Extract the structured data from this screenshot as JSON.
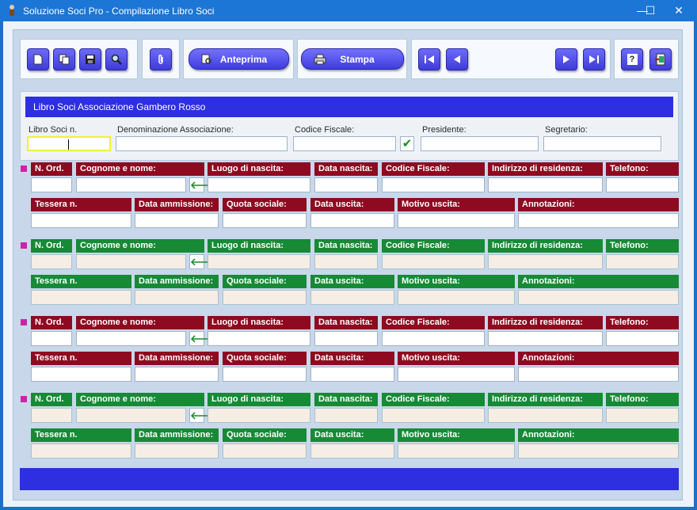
{
  "window": {
    "title": "Soluzione Soci Pro - Compilazione Libro Soci",
    "minimize": "—",
    "maximize": "☐",
    "close": "✕"
  },
  "toolbar": {
    "preview_label": "Anteprima",
    "print_label": "Stampa",
    "help_label": "?"
  },
  "header": {
    "title": "Libro Soci Associazione Gambero Rosso",
    "labels": {
      "libro_soci": "Libro Soci n.",
      "denominazione": "Denominazione Associazione:",
      "codice_fiscale": "Codice Fiscale:",
      "presidente": "Presidente:",
      "segretario": "Segretario:"
    },
    "check_symbol": "✔"
  },
  "record_labels": {
    "n_ord": "N. Ord.",
    "cognome_nome": "Cognome e nome:",
    "luogo_nascita": "Luogo di nascita:",
    "data_nascita": "Data nascita:",
    "codice_fiscale": "Codice Fiscale:",
    "indirizzo": "Indirizzo di residenza:",
    "telefono": "Telefono:",
    "tessera": "Tessera n.",
    "data_ammissione": "Data ammissione:",
    "quota_sociale": "Quota sociale:",
    "data_uscita": "Data uscita:",
    "motivo_uscita": "Motivo uscita:",
    "annotazioni": "Annotazioni:"
  },
  "arrow_symbol": "🡐",
  "colors": {
    "record_red": "#8e0a20",
    "record_green": "#178a36",
    "accent_blue": "#2d2fe0",
    "marker": "#d022a8"
  }
}
